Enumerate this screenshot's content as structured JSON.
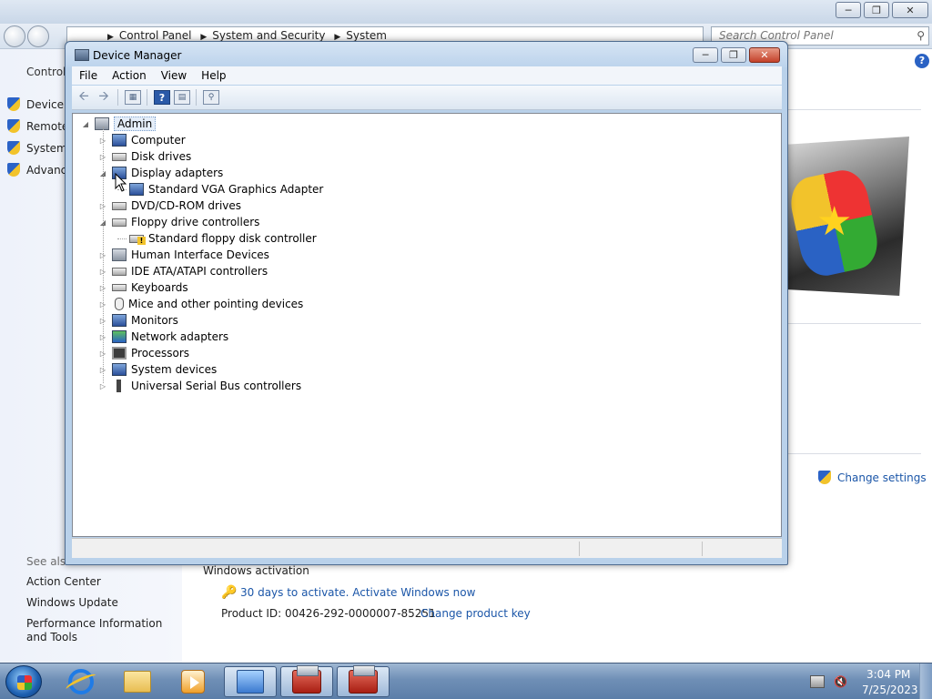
{
  "system_window": {
    "address": [
      "Control Panel",
      "System and Security",
      "System"
    ],
    "search_placeholder": "Search Control Panel",
    "sidebar": {
      "title": "Control",
      "tasks": [
        "Device M",
        "Remote",
        "System",
        "Advanc"
      ],
      "see_also_label": "See also",
      "see_also": [
        "Action Center",
        "Windows Update",
        "Performance Information and Tools"
      ]
    },
    "change_settings": "Change settings",
    "activation": {
      "title": "Windows activation",
      "activate_link": "30 days to activate. Activate Windows now",
      "product_id": "Product ID: 00426-292-0000007-85251",
      "change_key": "Change product key"
    }
  },
  "device_manager": {
    "title": "Device Manager",
    "menu": [
      "File",
      "Action",
      "View",
      "Help"
    ],
    "tree": {
      "root": "Admin",
      "nodes": [
        {
          "label": "Computer",
          "icon": "computer-icon",
          "state": "collapsed"
        },
        {
          "label": "Disk drives",
          "icon": "disk-drive-icon",
          "state": "collapsed"
        },
        {
          "label": "Display adapters",
          "icon": "display-adapter-icon",
          "state": "expanded",
          "children": [
            "Standard VGA Graphics Adapter"
          ]
        },
        {
          "label": "DVD/CD-ROM drives",
          "icon": "dvd-drive-icon",
          "state": "collapsed"
        },
        {
          "label": "Floppy drive controllers",
          "icon": "floppy-controller-icon",
          "state": "expanded",
          "children": [
            "Standard floppy disk controller"
          ]
        },
        {
          "label": "Human Interface Devices",
          "icon": "hid-icon",
          "state": "collapsed"
        },
        {
          "label": "IDE ATA/ATAPI controllers",
          "icon": "ide-controller-icon",
          "state": "collapsed"
        },
        {
          "label": "Keyboards",
          "icon": "keyboard-icon",
          "state": "collapsed"
        },
        {
          "label": "Mice and other pointing devices",
          "icon": "mouse-icon",
          "state": "collapsed"
        },
        {
          "label": "Monitors",
          "icon": "monitor-icon",
          "state": "collapsed"
        },
        {
          "label": "Network adapters",
          "icon": "network-adapter-icon",
          "state": "collapsed"
        },
        {
          "label": "Processors",
          "icon": "processor-icon",
          "state": "collapsed"
        },
        {
          "label": "System devices",
          "icon": "system-devices-icon",
          "state": "collapsed"
        },
        {
          "label": "Universal Serial Bus controllers",
          "icon": "usb-icon",
          "state": "collapsed"
        }
      ]
    }
  },
  "taskbar": {
    "pinned": [
      "start-orb",
      "internet-explorer-icon",
      "windows-explorer-icon",
      "media-player-icon",
      "control-panel-icon",
      "device-manager-icon",
      "computer-management-icon"
    ],
    "clock_time": "3:04 PM",
    "clock_date": "7/25/2023"
  },
  "colors": {
    "link": "#1b56a8",
    "window_frame": "#b9d1ea",
    "taskbar": "#6f8fb6"
  }
}
